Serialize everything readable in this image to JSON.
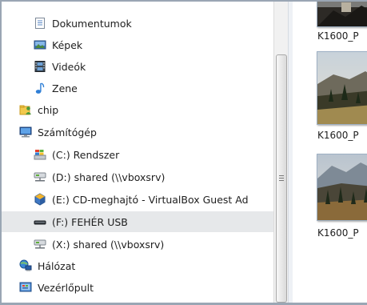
{
  "nav": {
    "items": [
      {
        "label": "Dokumentumok",
        "icon": "documents-icon"
      },
      {
        "label": "Képek",
        "icon": "pictures-icon"
      },
      {
        "label": "Videók",
        "icon": "videos-icon"
      },
      {
        "label": "Zene",
        "icon": "music-icon"
      },
      {
        "label": "chip",
        "icon": "user-folder-icon"
      },
      {
        "label": "Számítógép",
        "icon": "computer-icon"
      },
      {
        "label": "(C:) Rendszer",
        "icon": "system-drive-icon"
      },
      {
        "label": "(D:) shared (\\\\vboxsrv)",
        "icon": "network-drive-icon"
      },
      {
        "label": "(E:) CD-meghajtó - VirtualBox Guest Ad",
        "icon": "cd-drive-icon"
      },
      {
        "label": "(F:) FEHÉR USB",
        "icon": "usb-drive-icon"
      },
      {
        "label": "(X:) shared (\\\\vboxsrv)",
        "icon": "network-drive-icon"
      },
      {
        "label": "Hálózat",
        "icon": "network-icon"
      },
      {
        "label": "Vezérlőpult",
        "icon": "control-panel-icon"
      }
    ],
    "selected_index": 9
  },
  "content": {
    "thumbnails": [
      {
        "caption": "K1600_P"
      },
      {
        "caption": "K1600_P"
      },
      {
        "caption": "K1600_P"
      }
    ]
  }
}
